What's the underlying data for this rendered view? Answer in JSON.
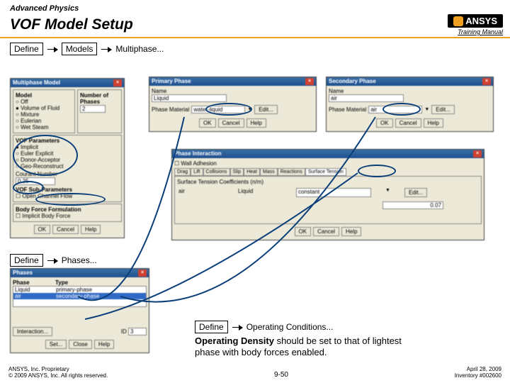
{
  "header": {
    "subtitle": "Advanced Physics",
    "title": "VOF Model Setup",
    "logo_text": "ANSYS",
    "manual": "Training Manual"
  },
  "breadcrumb1": {
    "a": "Define",
    "b": "Models",
    "c": "Multiphase..."
  },
  "breadcrumb2": {
    "a": "Define",
    "b": "Phases..."
  },
  "breadcrumb3": {
    "a": "Define",
    "b": "Operating Conditions..."
  },
  "note_html": "Operating Density should be set to that of lightest phase with body forces enabled.",
  "note_bold": "Operating Density",
  "note_rest": " should be set to that of lightest phase with body forces enabled.",
  "multiphase_dialog": {
    "title": "Multiphase Model",
    "model_header": "Model",
    "num_header": "Number of Phases",
    "opt_off": "Off",
    "opt_vof": "Volume of Fluid",
    "opt_mix": "Mixture",
    "opt_eul": "Eulerian",
    "opt_wet": "Wet Steam",
    "num_val": "2",
    "vof_params": "VOF Parameters",
    "imp": "Implicit",
    "eexp": "Euler Explicit",
    "da": "Donor-Acceptor",
    "gr": "Geo-Reconstruct",
    "courant_label": "Courant Number",
    "courant": "0.25",
    "vof_sub": "VOF Sub-Parameters",
    "open_chan": "Open Channel Flow",
    "body_force": "Body Force Formulation",
    "ibf": "Implicit Body Force",
    "ok": "OK",
    "cancel": "Cancel",
    "help": "Help"
  },
  "primary": {
    "title": "Primary Phase",
    "name_label": "Name",
    "name_val": "Liquid",
    "mat_label": "Phase Material",
    "mat_val": "water-liquid",
    "edit": "Edit...",
    "ok": "OK",
    "cancel": "Cancel",
    "help": "Help"
  },
  "secondary": {
    "title": "Secondary Phase",
    "name_label": "Name",
    "name_val": "air",
    "mat_label": "Phase Material",
    "mat_val": "air",
    "edit": "Edit...",
    "ok": "OK",
    "cancel": "Cancel",
    "help": "Help"
  },
  "interaction": {
    "title": "Phase Interaction",
    "wall": "Wall Adhesion",
    "tabs": [
      "Drag",
      "Lift",
      "Collisions",
      "Slip",
      "Heat",
      "Mass",
      "Reactions",
      "Surface Tension"
    ],
    "sect": "Surface Tension Coefficients (n/m)",
    "col1": "air",
    "col2": "Liquid",
    "type": "constant",
    "val": "0.07",
    "ok": "OK",
    "cancel": "Cancel",
    "help": "Help"
  },
  "phases_dialog": {
    "title": "Phases",
    "col_phase": "Phase",
    "col_type": "Type",
    "row1p": "Liquid",
    "row1t": "primary-phase",
    "row2p": "air",
    "row2t": "secondary-phase",
    "id_label": "ID",
    "id_val": "3",
    "interact": "Interaction...",
    "set": "Set...",
    "close": "Close",
    "help": "Help"
  },
  "footer": {
    "left1": "ANSYS, Inc. Proprietary",
    "left2": "© 2009 ANSYS, Inc.  All rights reserved.",
    "center": "9-50",
    "right1": "April 28, 2009",
    "right2": "Inventory #002600"
  }
}
